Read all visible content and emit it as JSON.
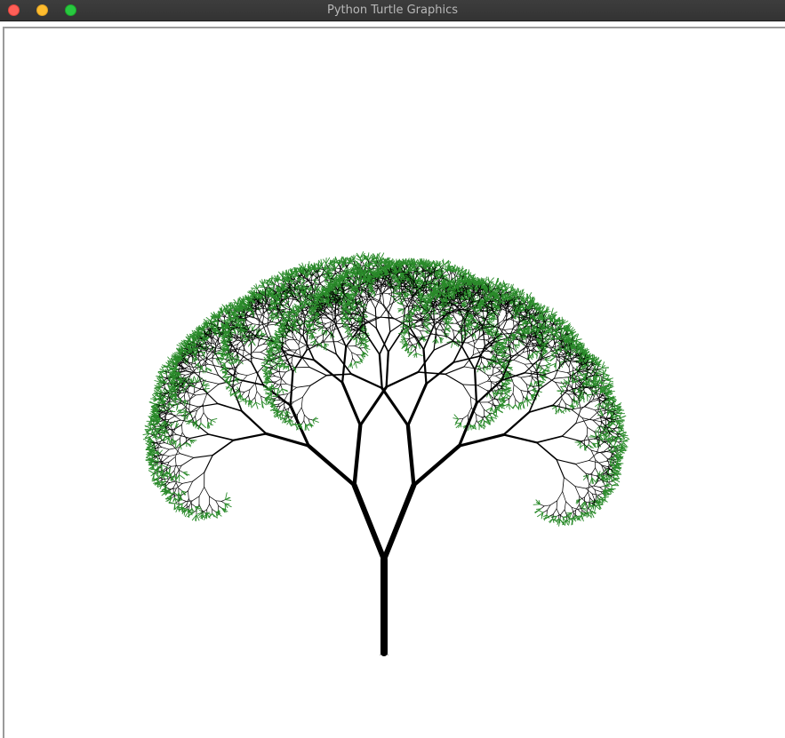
{
  "window": {
    "title": "Python Turtle Graphics"
  },
  "colors": {
    "titlebar": "#363636",
    "close": "#ff5f57",
    "minimize": "#febc2e",
    "maximize": "#28c840",
    "branch": "#000000",
    "leaf": "#2a8a2a",
    "canvas": "#ffffff"
  },
  "canvas": {
    "content": "recursive-fractal-tree"
  }
}
